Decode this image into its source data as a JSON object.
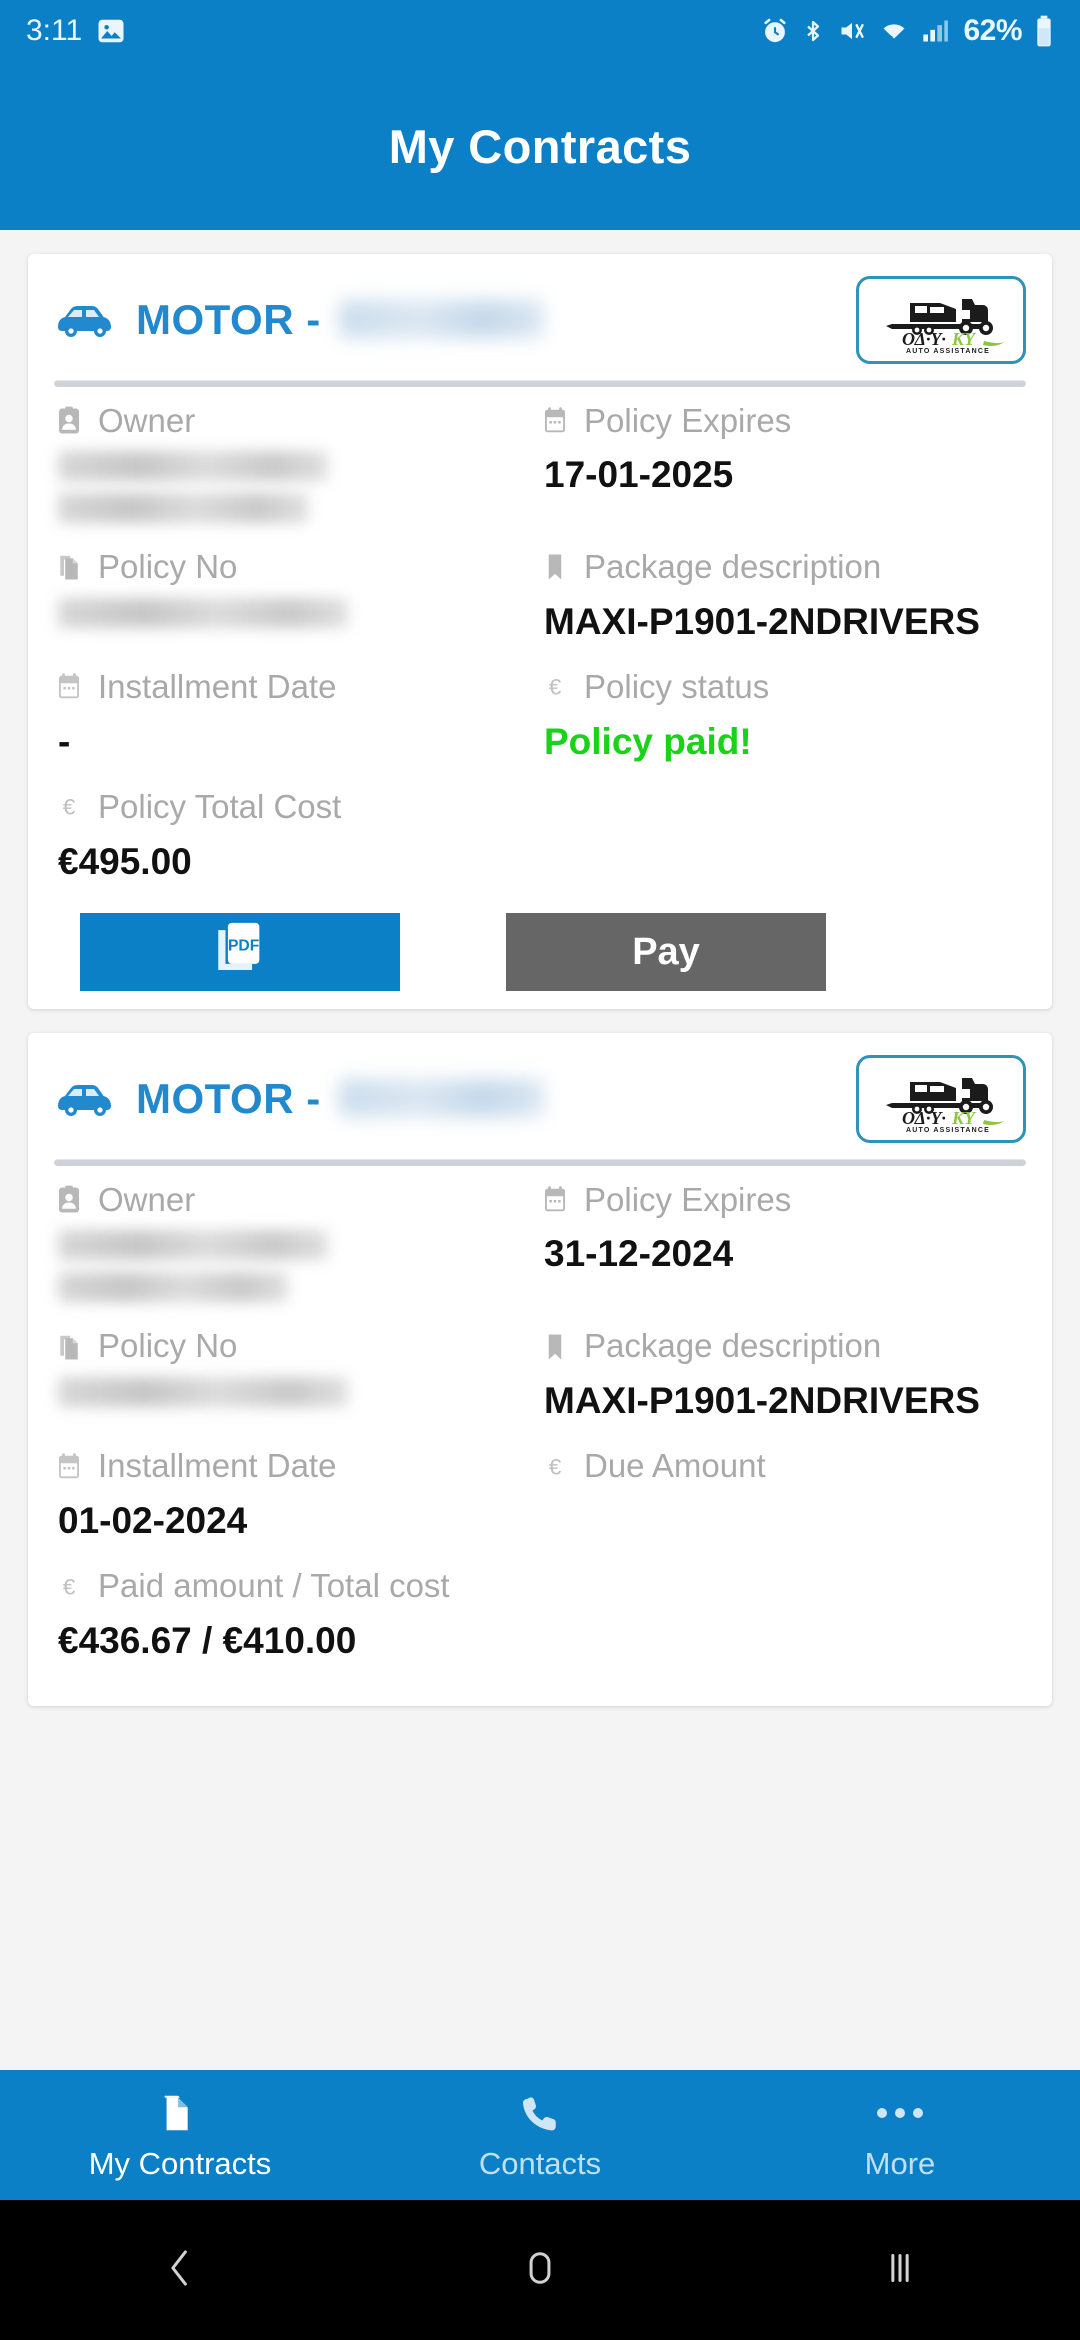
{
  "status_bar": {
    "time": "3:11",
    "battery_percent": "62%",
    "icons": [
      "screenshot-icon",
      "alarm-icon",
      "bluetooth-icon",
      "mute-icon",
      "wifi-icon",
      "signal-icon",
      "battery-icon"
    ]
  },
  "app_bar": {
    "title": "My Contracts"
  },
  "colors": {
    "brand_blue": "#0b80c6",
    "motor_blue": "#2389ce",
    "paid_green": "#19d318",
    "pay_disabled_gray": "#666666",
    "label_gray": "#a9a9a9"
  },
  "logo": {
    "name": "odyky-auto-assistance-logo",
    "brand": "ΟΔ·Υ·ΚΥ",
    "tagline": "AUTO ASSISTANCE"
  },
  "contracts": [
    {
      "type_label": "MOTOR - ",
      "plate": "",
      "fields": {
        "owner_label": "Owner",
        "owner_value": "",
        "expires_label": "Policy Expires",
        "expires_value": "17-01-2025",
        "policy_no_label": "Policy No",
        "policy_no_value": "",
        "package_label": "Package description",
        "package_value": "MAXI-P1901-2NDRIVERS",
        "installment_label": "Installment Date",
        "installment_value": "-",
        "status_label": "Policy status",
        "status_value": "Policy paid!",
        "total_cost_label": "Policy Total Cost",
        "total_cost_value": "€495.00"
      },
      "buttons": {
        "pdf_label": "PDF",
        "pay_label": "Pay"
      }
    },
    {
      "type_label": "MOTOR - ",
      "plate": "",
      "fields": {
        "owner_label": "Owner",
        "owner_value": "",
        "expires_label": "Policy Expires",
        "expires_value": "31-12-2024",
        "policy_no_label": "Policy No",
        "policy_no_value": "",
        "package_label": "Package description",
        "package_value": "MAXI-P1901-2NDRIVERS",
        "installment_label": "Installment Date",
        "installment_value": "01-02-2024",
        "due_label": "Due Amount",
        "due_value": "",
        "paid_label": "Paid amount / Total cost",
        "paid_value": "€436.67 / €410.00"
      }
    }
  ],
  "bottom_nav": {
    "items": [
      {
        "label": "My Contracts",
        "icon": "document-icon",
        "active": true
      },
      {
        "label": "Contacts",
        "icon": "phone-icon",
        "active": false
      },
      {
        "label": "More",
        "icon": "ellipsis-icon",
        "active": false
      }
    ]
  },
  "android_nav": {
    "back": "back-icon",
    "home": "home-icon",
    "recents": "recents-icon"
  }
}
